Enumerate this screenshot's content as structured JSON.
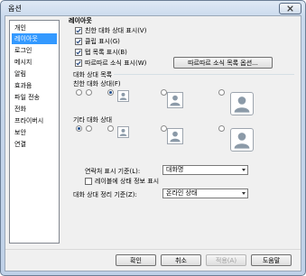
{
  "window": {
    "title": "옵션"
  },
  "sidebar": {
    "items": [
      {
        "label": "개인"
      },
      {
        "label": "레이아웃"
      },
      {
        "label": "로그인"
      },
      {
        "label": "메시지"
      },
      {
        "label": "알림"
      },
      {
        "label": "효과음"
      },
      {
        "label": "파일 전송"
      },
      {
        "label": "전화"
      },
      {
        "label": "프라이버시"
      },
      {
        "label": "보안"
      },
      {
        "label": "연결"
      }
    ],
    "selected_index": 1
  },
  "layout": {
    "title": "레이아웃",
    "options": [
      {
        "label": "친한 대화 상대 표시(V)",
        "checked": true
      },
      {
        "label": "클립 표시(G)",
        "checked": true
      },
      {
        "label": "탭 목록 표시(B)",
        "checked": true
      },
      {
        "label": "따르따르 소식 표시(W)",
        "checked": true
      }
    ],
    "news_options_button": "따르따르 소식 목록 옵션..."
  },
  "contact_list": {
    "title": "대화 상대 목록",
    "favorites_label": "친한 대화 상대(F)",
    "others_label": "기타 대화 상대"
  },
  "display_name": {
    "label": "연락처 표시 기준(L):",
    "value": "대화명"
  },
  "status_message": {
    "label": "레이블에 상태 정보 표시",
    "checked": false
  },
  "sort": {
    "label": "대화 상대 정리 기준(Z):",
    "value": "온라인 상태"
  },
  "footer": {
    "ok": "확인",
    "cancel": "취소",
    "apply": "적용(A)",
    "help": "도움말"
  }
}
